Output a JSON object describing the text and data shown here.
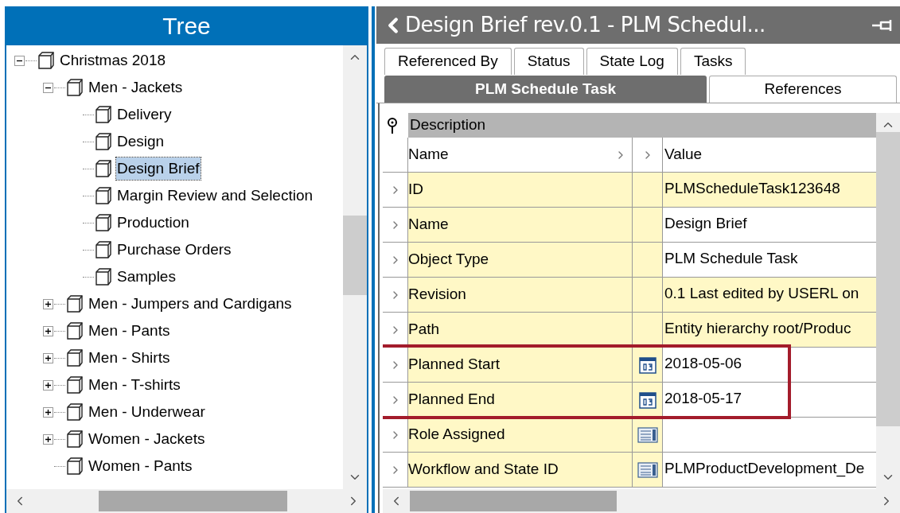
{
  "tree": {
    "title": "Tree",
    "nodes": [
      {
        "label": "Christmas 2018",
        "expanded": true,
        "selected": false,
        "children": [
          {
            "label": "Men - Jackets",
            "expanded": true,
            "selected": false,
            "children": [
              {
                "label": "Delivery",
                "selected": false
              },
              {
                "label": "Design",
                "selected": false
              },
              {
                "label": "Design Brief",
                "selected": true
              },
              {
                "label": "Margin Review and Selection",
                "selected": false
              },
              {
                "label": "Production",
                "selected": false
              },
              {
                "label": "Purchase Orders",
                "selected": false
              },
              {
                "label": "Samples",
                "selected": false
              }
            ]
          },
          {
            "label": "Men - Jumpers and Cardigans",
            "expanded": false,
            "selected": false
          },
          {
            "label": "Men - Pants",
            "expanded": false,
            "selected": false
          },
          {
            "label": "Men - Shirts",
            "expanded": false,
            "selected": false
          },
          {
            "label": "Men - T-shirts",
            "expanded": false,
            "selected": false
          },
          {
            "label": "Men - Underwear",
            "expanded": false,
            "selected": false
          },
          {
            "label": "Women - Jackets",
            "expanded": false,
            "selected": false
          },
          {
            "label": "Women - Pants",
            "selected": false
          }
        ]
      }
    ]
  },
  "detail": {
    "title": "Design Brief rev.0.1 - PLM Schedul...",
    "tab_rows": [
      {
        "tabs": [
          {
            "label": "Referenced By",
            "selected": false
          },
          {
            "label": "Status",
            "selected": false
          },
          {
            "label": "State Log",
            "selected": false
          },
          {
            "label": "Tasks",
            "selected": false
          }
        ]
      },
      {
        "tabs": [
          {
            "label": "PLM Schedule Task",
            "selected": true
          },
          {
            "label": "References",
            "selected": false
          }
        ]
      }
    ],
    "grid": {
      "section": "Description",
      "columns": [
        "Name",
        "Value"
      ],
      "rows": [
        {
          "name": "ID",
          "kind": "text",
          "value": "PLMScheduleTask123648",
          "value_highlighted": true,
          "marked": false
        },
        {
          "name": "Name",
          "kind": "text",
          "value": "Design Brief",
          "value_highlighted": false,
          "marked": false
        },
        {
          "name": "Object Type",
          "kind": "text",
          "value": "PLM Schedule Task",
          "value_highlighted": false,
          "marked": false
        },
        {
          "name": "Revision",
          "kind": "text",
          "value": "0.1 Last edited by USERL on",
          "value_highlighted": true,
          "marked": false
        },
        {
          "name": "Path",
          "kind": "text",
          "value": "Entity hierarchy root/Produc",
          "value_highlighted": true,
          "marked": false
        },
        {
          "name": "Planned Start",
          "kind": "date",
          "value": "2018-05-06",
          "value_highlighted": false,
          "marked": true
        },
        {
          "name": "Planned End",
          "kind": "date",
          "value": "2018-05-17",
          "value_highlighted": false,
          "marked": true
        },
        {
          "name": "Role Assigned",
          "kind": "list",
          "value_highlighted": false,
          "marked": false
        },
        {
          "name": "Workflow and State ID",
          "kind": "list",
          "value": "PLMProductDevelopment_De",
          "value_highlighted": false,
          "marked": false
        }
      ]
    }
  }
}
